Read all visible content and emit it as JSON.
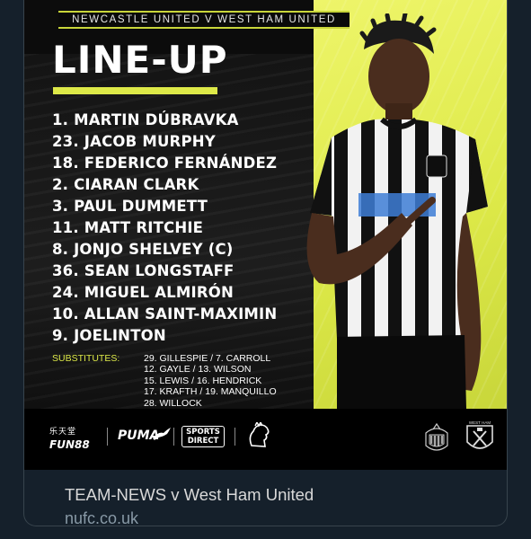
{
  "graphic": {
    "match": "NEWCASTLE UNITED V WEST HAM UNITED",
    "title": "LINE-UP",
    "lineup": [
      "1. MARTIN DÚBRAVKA",
      "23. JACOB MURPHY",
      "18. FEDERICO FERNÁNDEZ",
      "2. CIARAN CLARK",
      "3. PAUL DUMMETT",
      "11. MATT RITCHIE",
      "8. JONJO SHELVEY (C)",
      "36. SEAN LONGSTAFF",
      "24. MIGUEL ALMIRÓN",
      "10. ALLAN SAINT-MAXIMIN",
      "9. JOELINTON"
    ],
    "substitutes_label": "SUBSTITUTES:",
    "substitutes": [
      "29. GILLESPIE / 7. CARROLL",
      "12. GAYLE / 13. WILSON",
      "15. LEWIS / 16. HENDRICK",
      "17. KRAFTH / 19. MANQUILLO",
      "28. WILLOCK"
    ],
    "sponsors": {
      "fun88_cn": "乐天堂",
      "fun88": "FUN88",
      "puma": "PUMA",
      "sports_direct_1": "SPORTS",
      "sports_direct_2": "DIRECT"
    },
    "crest_whu_text": "WEST HAM",
    "colors": {
      "accent": "#dde948",
      "background": "#0c0c0c"
    }
  },
  "link": {
    "title": "TEAM-NEWS v West Ham United",
    "domain": "nufc.co.uk"
  }
}
